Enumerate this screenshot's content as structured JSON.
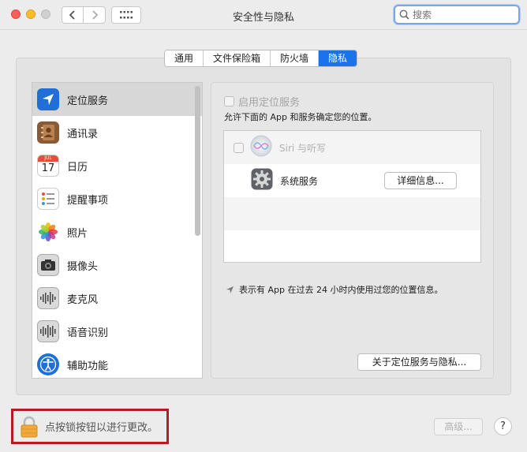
{
  "window": {
    "title": "安全性与隐私"
  },
  "search": {
    "placeholder": "搜索",
    "value": ""
  },
  "tabs": [
    {
      "label": "通用",
      "active": false
    },
    {
      "label": "文件保险箱",
      "active": false
    },
    {
      "label": "防火墙",
      "active": false
    },
    {
      "label": "隐私",
      "active": true
    }
  ],
  "sidebar": {
    "items": [
      {
        "label": "定位服务",
        "icon": "location-arrow-icon",
        "selected": true
      },
      {
        "label": "通讯录",
        "icon": "contacts-book-icon"
      },
      {
        "label": "日历",
        "icon": "calendar-icon",
        "day": "17",
        "month": "JUL"
      },
      {
        "label": "提醒事项",
        "icon": "reminders-icon"
      },
      {
        "label": "照片",
        "icon": "photos-icon"
      },
      {
        "label": "摄像头",
        "icon": "camera-icon"
      },
      {
        "label": "麦克风",
        "icon": "microphone-icon"
      },
      {
        "label": "语音识别",
        "icon": "speech-recognition-icon"
      },
      {
        "label": "辅助功能",
        "icon": "accessibility-icon"
      }
    ]
  },
  "location": {
    "enable_label": "启用定位服务",
    "enabled": false,
    "allow_text": "允许下面的 App 和服务确定您的位置。",
    "apps": [
      {
        "name": "Siri 与听写",
        "checked": false,
        "dimmed": true
      },
      {
        "name": "系统服务",
        "details_label": "详细信息..."
      }
    ],
    "legend_text": "表示有 App 在过去 24 小时内使用过您的位置信息。",
    "about_label": "关于定位服务与隐私..."
  },
  "footer": {
    "lock_text": "点按锁按钮以进行更改。",
    "advanced_label": "高级...",
    "help_label": "?"
  },
  "colors": {
    "accent": "#1a73e8",
    "lock_highlight": "#b71c1c"
  }
}
